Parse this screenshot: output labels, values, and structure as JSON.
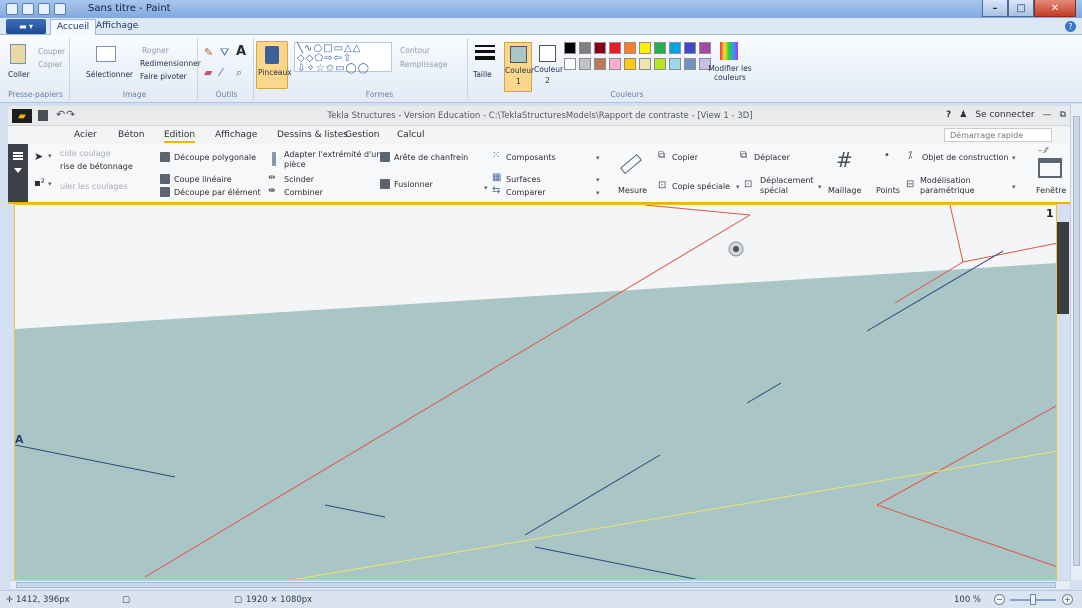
{
  "paint": {
    "title": "Sans titre - Paint",
    "tabs": [
      "Accueil",
      "Affichage"
    ],
    "active_tab": "Accueil",
    "clipboard": {
      "paste": "Coller",
      "cut": "Couper",
      "copy": "Copier",
      "group": "Presse-papiers"
    },
    "image": {
      "select": "Sélectionner",
      "crop": "Rogner",
      "resize": "Redimensionner",
      "rotate": "Faire pivoter",
      "group": "Image"
    },
    "tools": {
      "group": "Outils"
    },
    "brushes": {
      "label": "Pinceaux"
    },
    "shapes": {
      "outline": "Contour",
      "fill": "Remplissage",
      "group": "Formes"
    },
    "size": {
      "label": "Taille"
    },
    "colors": {
      "color1": "Couleur",
      "color1_num": "1",
      "color2": "Couleur",
      "color2_num": "2",
      "edit": "Modifier les couleurs",
      "group": "Couleurs",
      "palette_row1": [
        "#000000",
        "#7f7f7f",
        "#880015",
        "#ed1c24",
        "#ff7f27",
        "#fff200",
        "#22b14c",
        "#00a2e8",
        "#3f48cc",
        "#a349a4"
      ],
      "palette_row2": [
        "#ffffff",
        "#c3c3c3",
        "#b97a57",
        "#ffaec9",
        "#ffc90e",
        "#efe4b0",
        "#b5e61d",
        "#99d9ea",
        "#7092be",
        "#c8bfe7"
      ]
    },
    "status": {
      "cursor": "1412, 396px",
      "canvas_size": "1920 × 1080px",
      "zoom": "100 %"
    }
  },
  "tekla": {
    "title": "Tekla Structures - Version Education - C:\\TeklaStructuresModels\\Rapport de contraste - [View 1 - 3D]",
    "help": "?",
    "connect": "Se connecter",
    "tabs": [
      "Acier",
      "Béton",
      "Edition",
      "Affichage",
      "Dessins & listes",
      "Gestion",
      "Calcul"
    ],
    "active_tab": "Edition",
    "quick_launch_placeholder": "Démarrage rapide",
    "ribbon": {
      "pour1": "cide coulage",
      "pour2": "rise de bétonnage",
      "pour3": "uler les coulages",
      "polygon_cut": "Découpe polygonale",
      "line_cut": "Coupe linéaire",
      "part_cut": "Découpe par élément",
      "fit_end1": "Adapter l'extrémité d'une",
      "fit_end2": "pièce",
      "split": "Scinder",
      "combine": "Combiner",
      "chamfer": "Arête de chanfrein",
      "merge": "Fusionner",
      "components": "Composants",
      "surfaces": "Surfaces",
      "compare": "Comparer",
      "measure": "Mesure",
      "copy": "Copier",
      "copy_special": "Copie spéciale",
      "move": "Déplacer",
      "move_special1": "Déplacement",
      "move_special2": "spécial",
      "mesh": "Maillage",
      "points": "Points",
      "construction_object": "Objet de construction",
      "parametric1": "Modélisation",
      "parametric2": "paramétrique",
      "window": "Fenêtre"
    },
    "view": {
      "number": "1",
      "grid_label": "A",
      "sky_color": "#f4f5f6",
      "ground_color": "#a9c5c5",
      "red_line_color": "#e0554d",
      "yellow_line_color": "#e8e86a",
      "blue_line_color": "#2c4a7c"
    }
  }
}
